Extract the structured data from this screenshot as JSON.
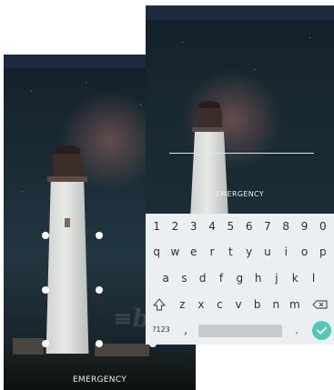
{
  "left_screen": {
    "emergency_label": "EMERGENCY",
    "pattern_dot_count": 9
  },
  "right_screen": {
    "emergency_label": "EMERGENCY",
    "keyboard": {
      "number_row": [
        "1",
        "2",
        "3",
        "4",
        "5",
        "6",
        "7",
        "8",
        "9",
        "0"
      ],
      "row1": [
        "q",
        "w",
        "e",
        "r",
        "t",
        "y",
        "u",
        "i",
        "o",
        "p"
      ],
      "row2": [
        "a",
        "s",
        "d",
        "f",
        "g",
        "h",
        "j",
        "k",
        "l"
      ],
      "row3": [
        "z",
        "x",
        "c",
        "v",
        "b",
        "n",
        "m"
      ],
      "symbols_label": "?123",
      "comma_label": ",",
      "period_label": "."
    }
  },
  "colors": {
    "accent": "#4fc8b4",
    "status_bar": "#1e2a40",
    "keyboard_bg": "#eceff1"
  },
  "icons": {
    "shift": "shift-icon",
    "backspace": "backspace-icon",
    "enter": "checkmark-icon"
  }
}
